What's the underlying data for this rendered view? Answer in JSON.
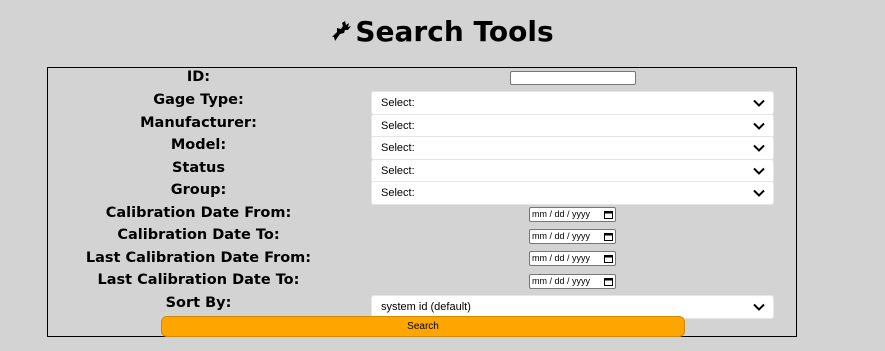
{
  "page": {
    "title": "Search Tools",
    "logo_icon": "deer-icon"
  },
  "form": {
    "id_label": "ID:",
    "id_value": "",
    "gage_type_label": "Gage Type:",
    "gage_type_value": "Select:",
    "manufacturer_label": "Manufacturer:",
    "manufacturer_value": "Select:",
    "model_label": "Model:",
    "model_value": "Select:",
    "status_label": "Status",
    "status_value": "Select:",
    "group_label": "Group:",
    "group_value": "Select:",
    "cal_from_label": "Calibration Date From:",
    "cal_from_placeholder": "mm / dd / yyyy",
    "cal_to_label": "Calibration Date To:",
    "cal_to_placeholder": "mm / dd / yyyy",
    "last_cal_from_label": "Last Calibration Date From:",
    "last_cal_from_placeholder": "mm / dd / yyyy",
    "last_cal_to_label": "Last Calibration Date To:",
    "last_cal_to_placeholder": "mm / dd / yyyy",
    "sort_by_label": "Sort By:",
    "sort_by_value": "system id (default)",
    "search_button": "Search"
  },
  "colors": {
    "background": "#d3d3d3",
    "button": "#ffa500"
  }
}
